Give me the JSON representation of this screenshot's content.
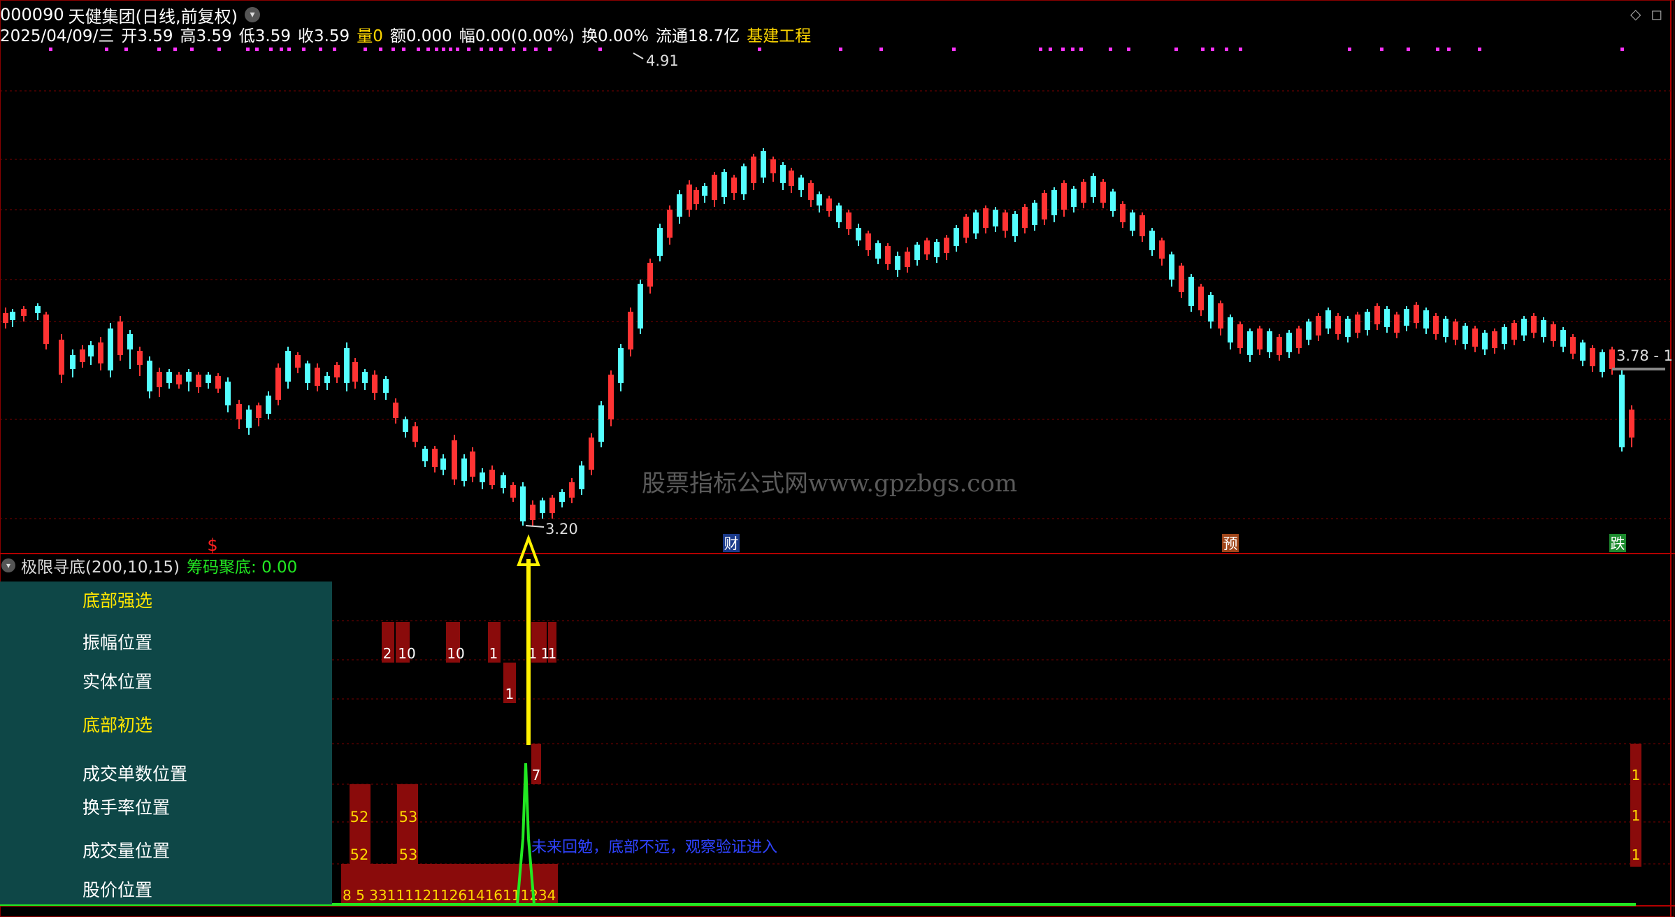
{
  "header": {
    "code": "000090",
    "name": "天健集团",
    "period_label": "(日线,前复权)",
    "window_icons": [
      "diamond-icon",
      "maximize-icon"
    ]
  },
  "quote": {
    "date": "2025/04/09/三",
    "open": "开3.59",
    "high": "高3.59",
    "low": "低3.59",
    "close": "收3.59",
    "volume": "量0",
    "amount": "额0.000",
    "change": "幅0.00(0.00%)",
    "turnover": "换0.00%",
    "float": "流通18.7亿",
    "sector": "基建工程"
  },
  "price_chart": {
    "high_marker": "4.91",
    "low_marker": "3.20",
    "last_price_label": "3.78 - 1",
    "event_markers": [
      {
        "label": "$",
        "color": "#ff2020"
      },
      {
        "label": "财",
        "color": "#1a3a8a"
      },
      {
        "label": "预",
        "color": "#a0461a"
      },
      {
        "label": "跌",
        "color": "#1c8a2e"
      }
    ],
    "colors": {
      "up": "#ff3333",
      "down": "#54ffff",
      "grid": "#7a0000",
      "marker_dots": "#ff33ff"
    }
  },
  "watermark": "股票指标公式网www.gpzbgs.com",
  "indicator": {
    "name": "极限寻底(200,10,15)",
    "value_label": "筹码聚底: 0.00",
    "panel_labels": [
      {
        "text": "底部强选",
        "highlight": true
      },
      {
        "text": "振幅位置",
        "highlight": false
      },
      {
        "text": "实体位置",
        "highlight": false
      },
      {
        "text": "底部初选",
        "highlight": true
      },
      {
        "text": "成交单数位置",
        "highlight": false
      },
      {
        "text": "换手率位置",
        "highlight": false
      },
      {
        "text": "成交量位置",
        "highlight": false
      },
      {
        "text": "股价位置",
        "highlight": false
      }
    ],
    "note": "未来回勉，底部不远，观察验证进入",
    "rows": {
      "amplitude": [
        "2",
        "10",
        "10",
        "1",
        "1",
        "1",
        "1"
      ],
      "body": [
        "1"
      ],
      "orders": [
        "7",
        "1"
      ],
      "turnover": [
        "52",
        "53",
        "1"
      ],
      "volume": [
        "52",
        "53",
        "1"
      ],
      "price": "8 5 331111211261416111234"
    }
  }
}
